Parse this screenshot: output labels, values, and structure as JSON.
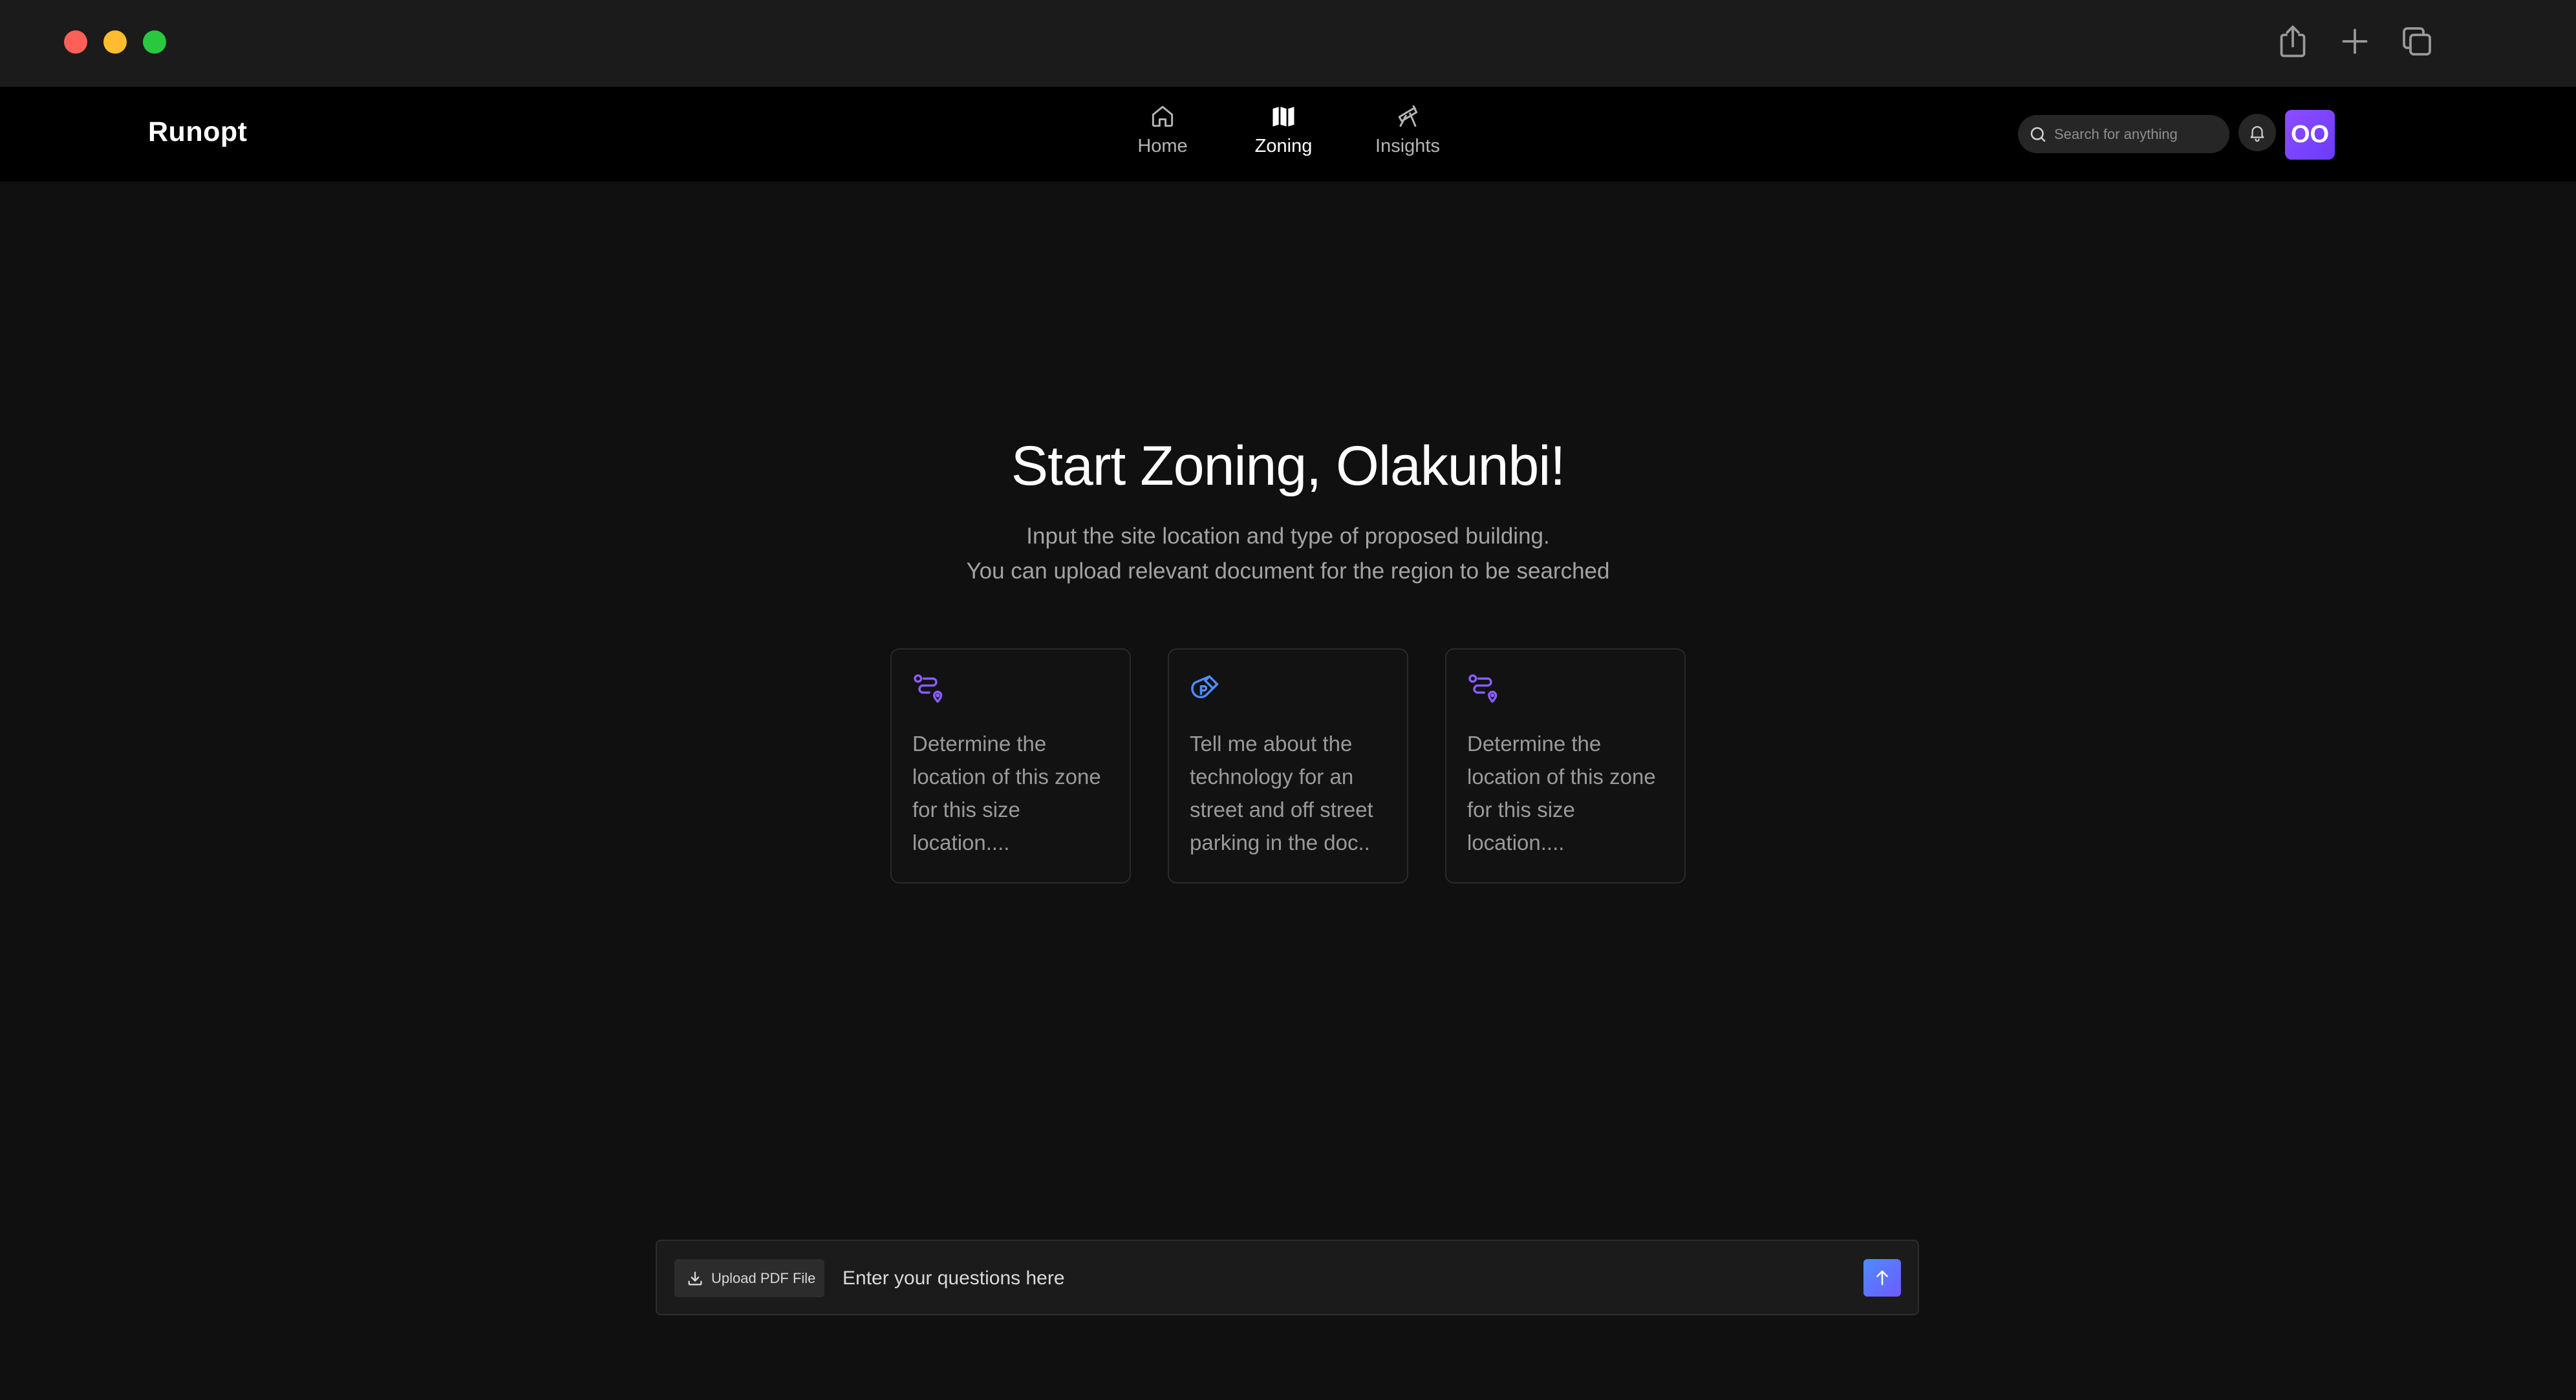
{
  "titlebar": {
    "icons": [
      "share-icon",
      "plus-icon",
      "copy-windows-icon"
    ]
  },
  "navbar": {
    "brand": "Runopt",
    "items": [
      {
        "label": "Home",
        "icon": "home-icon",
        "active": false
      },
      {
        "label": "Zoning",
        "icon": "map-icon",
        "active": true
      },
      {
        "label": "Insights",
        "icon": "telescope-icon",
        "active": false
      }
    ],
    "search_placeholder": "Search for anything",
    "avatar_initials": "OO"
  },
  "hero": {
    "title": "Start Zoning, Olakunbi!",
    "subtitle_line1": "Input the site location and type of proposed building.",
    "subtitle_line2": "You can upload relevant document for the region to be searched"
  },
  "cards": [
    {
      "icon": "route-icon",
      "text": "Determine the location of this zone for this size location...."
    },
    {
      "icon": "parking-magnet-icon",
      "text": "Tell me about the technology for an street and off street parking in the doc.."
    },
    {
      "icon": "route-icon",
      "text": "Determine the location of this zone for this size location...."
    }
  ],
  "composer": {
    "upload_label": "Upload PDF File",
    "placeholder": "Enter your questions here"
  },
  "colors": {
    "accent_purple": "#7c4dff",
    "accent_blue": "#4f8bff",
    "background": "#101010"
  }
}
